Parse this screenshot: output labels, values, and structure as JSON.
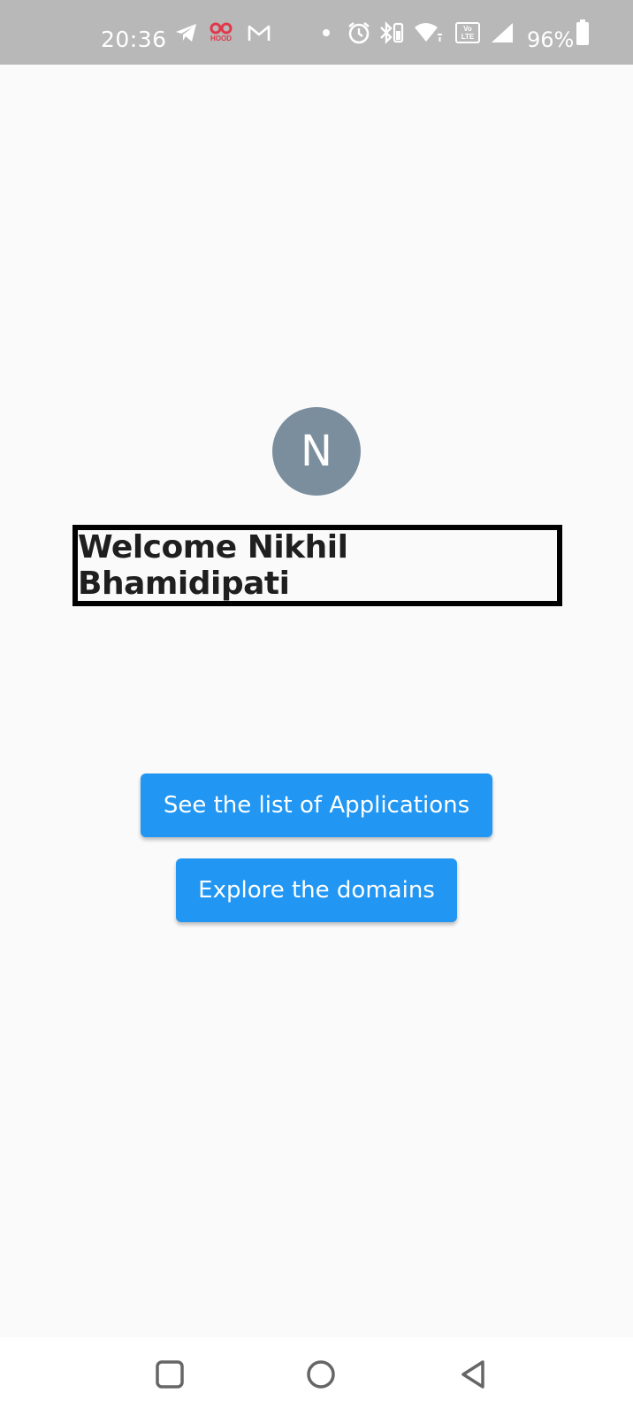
{
  "status_bar": {
    "time": "20:36",
    "battery_text": "96%",
    "icons": [
      "telegram-icon",
      "hood-icon",
      "gmail-icon",
      "dot-icon",
      "alarm-icon",
      "bluetooth-icon",
      "wifi-icon",
      "volte-icon",
      "signal-icon",
      "battery-icon"
    ],
    "hood_label": "HOOD",
    "volte_label": "Vo LTE"
  },
  "profile": {
    "avatar_initial": "N",
    "welcome_text": "Welcome Nikhil Bhamidipati"
  },
  "actions": {
    "applications_label": "See the list of Applications",
    "domains_label": "Explore the domains"
  },
  "nav_bar": {
    "icons": [
      "recents-icon",
      "home-icon",
      "back-icon"
    ]
  },
  "colors": {
    "status_bar_bg": "#b8b8b8",
    "page_bg": "#fafafa",
    "avatar_bg": "#7b8e9e",
    "button_bg": "#2196f3",
    "hood_red": "#e0384a"
  }
}
